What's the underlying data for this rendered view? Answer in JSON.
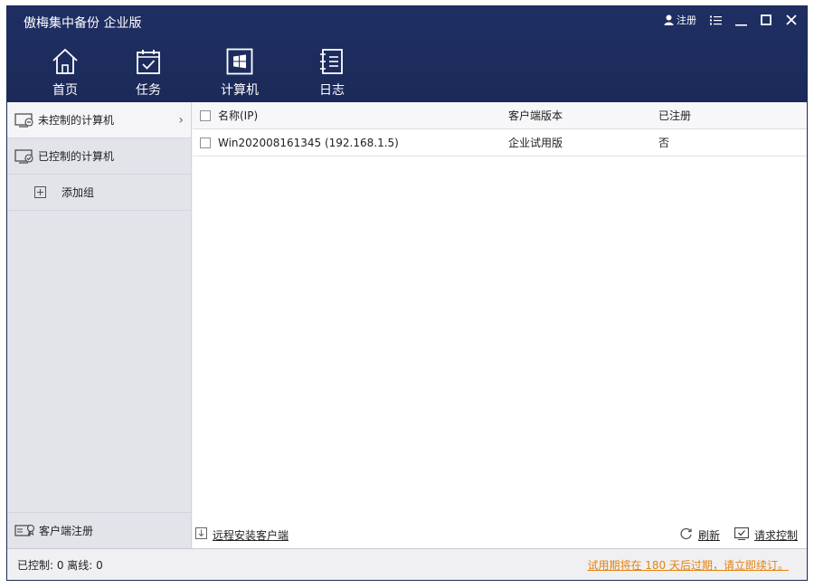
{
  "app": {
    "title": "傲梅集中备份 企业版"
  },
  "window_controls": {
    "register_label": "注册",
    "icons": [
      "user-icon",
      "menu-icon",
      "minimize-icon",
      "maximize-icon",
      "close-icon"
    ]
  },
  "nav": [
    {
      "label": "首页",
      "icon": "home-icon"
    },
    {
      "label": "任务",
      "icon": "task-calendar-icon"
    },
    {
      "label": "计算机",
      "icon": "windows-icon",
      "active": true
    },
    {
      "label": "日志",
      "icon": "log-notebook-icon"
    }
  ],
  "sidebar": {
    "items": [
      {
        "label": "未控制的计算机",
        "icon": "uncontrolled-computer-icon",
        "active": true
      },
      {
        "label": "已控制的计算机",
        "icon": "controlled-computer-icon"
      },
      {
        "label": "添加组",
        "icon": "plus-box-icon"
      }
    ],
    "bottom": {
      "label": "客户端注册",
      "icon": "client-register-icon"
    }
  },
  "table": {
    "headers": {
      "name": "名称(IP)",
      "version": "客户端版本",
      "registered": "已注册"
    },
    "rows": [
      {
        "name": "Win202008161345 (192.168.1.5)",
        "version": "企业试用版",
        "registered": "否"
      }
    ]
  },
  "footer": {
    "remote_install": "远程安装客户端",
    "refresh": "刷新",
    "request_control": "请求控制"
  },
  "statusbar": {
    "counts": "已控制: 0 离线: 0",
    "trial_notice": "试用期将在 180 天后过期，请立即续订。"
  },
  "colors": {
    "header_bg": "#1e2d5f",
    "sidebar_bg": "#e3e4ea",
    "trial_link": "#e3830f"
  }
}
